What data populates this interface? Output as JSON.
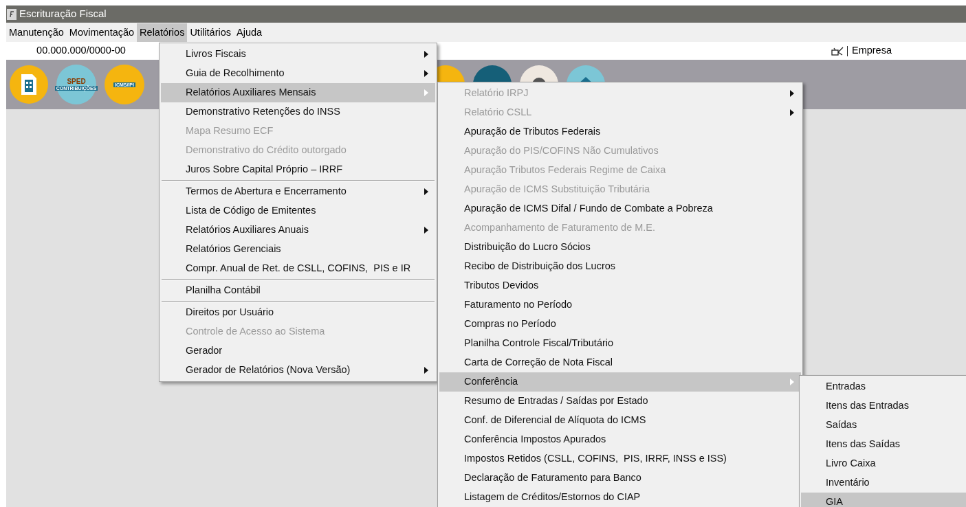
{
  "window": {
    "title": "Escrituração Fiscal"
  },
  "menubar": [
    {
      "label": "Manutenção",
      "selected": false
    },
    {
      "label": "Movimentação",
      "selected": false
    },
    {
      "label": "Relatórios",
      "selected": true
    },
    {
      "label": "Utilitários",
      "selected": false
    },
    {
      "label": "Ajuda",
      "selected": false
    }
  ],
  "company_bar": {
    "cnpj": "00.000.000/0000-00",
    "company_label": "Empresa"
  },
  "toolbar": [
    {
      "kind": "building"
    },
    {
      "kind": "sped",
      "labels": [
        "SPED",
        "CONTRIBUIÇÕES"
      ]
    },
    {
      "kind": "icms",
      "labels": [
        "ICMS/IPI"
      ]
    },
    {
      "kind": "yellow"
    },
    {
      "kind": "teal"
    },
    {
      "kind": "person"
    },
    {
      "kind": "house"
    }
  ],
  "menus": [
    {
      "items": [
        {
          "kind": "item",
          "label": "Livros Fiscais",
          "submenu": true,
          "disabled": false,
          "selected": false
        },
        {
          "kind": "item",
          "label": "Guia de Recolhimento",
          "submenu": true,
          "disabled": false,
          "selected": false
        },
        {
          "kind": "item",
          "label": "Relatórios Auxiliares Mensais",
          "submenu": true,
          "disabled": false,
          "selected": true
        },
        {
          "kind": "item",
          "label": "Demonstrativo Retenções do INSS",
          "submenu": false,
          "disabled": false,
          "selected": false
        },
        {
          "kind": "item",
          "label": "Mapa Resumo ECF",
          "submenu": false,
          "disabled": true,
          "selected": false
        },
        {
          "kind": "item",
          "label": "Demonstrativo do Crédito outorgado",
          "submenu": false,
          "disabled": true,
          "selected": false
        },
        {
          "kind": "item",
          "label": "Juros Sobre Capital Próprio – IRRF",
          "submenu": false,
          "disabled": false,
          "selected": false
        },
        {
          "kind": "separator"
        },
        {
          "kind": "item",
          "label": "Termos de Abertura e Encerramento",
          "submenu": true,
          "disabled": false,
          "selected": false
        },
        {
          "kind": "item",
          "label": "Lista de Código de Emitentes",
          "submenu": false,
          "disabled": false,
          "selected": false
        },
        {
          "kind": "item",
          "label": "Relatórios Auxiliares Anuais",
          "submenu": true,
          "disabled": false,
          "selected": false
        },
        {
          "kind": "item",
          "label": "Relatórios Gerenciais",
          "submenu": false,
          "disabled": false,
          "selected": false
        },
        {
          "kind": "item",
          "label": "Compr. Anual de Ret. de CSLL, COFINS,  PIS e IR",
          "submenu": false,
          "disabled": false,
          "selected": false
        },
        {
          "kind": "separator"
        },
        {
          "kind": "item",
          "label": "Planilha Contábil",
          "submenu": false,
          "disabled": false,
          "selected": false
        },
        {
          "kind": "separator"
        },
        {
          "kind": "item",
          "label": "Direitos por Usuário",
          "submenu": false,
          "disabled": false,
          "selected": false
        },
        {
          "kind": "item",
          "label": "Controle de Acesso ao Sistema",
          "submenu": false,
          "disabled": true,
          "selected": false
        },
        {
          "kind": "item",
          "label": "Gerador",
          "submenu": false,
          "disabled": false,
          "selected": false
        },
        {
          "kind": "item",
          "label": "Gerador de Relatórios (Nova Versão)",
          "submenu": true,
          "disabled": false,
          "selected": false
        }
      ]
    },
    {
      "items": [
        {
          "kind": "item",
          "label": "Relatório IRPJ",
          "submenu": true,
          "disabled": true,
          "selected": false
        },
        {
          "kind": "item",
          "label": "Relatório CSLL",
          "submenu": true,
          "disabled": true,
          "selected": false
        },
        {
          "kind": "item",
          "label": "Apuração de Tributos Federais",
          "submenu": false,
          "disabled": false,
          "selected": false
        },
        {
          "kind": "item",
          "label": "Apuração do PIS/COFINS Não Cumulativos",
          "submenu": false,
          "disabled": true,
          "selected": false
        },
        {
          "kind": "item",
          "label": "Apuração Tributos Federais Regime de Caixa",
          "submenu": false,
          "disabled": true,
          "selected": false
        },
        {
          "kind": "item",
          "label": "Apuração de ICMS Substituição Tributária",
          "submenu": false,
          "disabled": true,
          "selected": false
        },
        {
          "kind": "item",
          "label": "Apuração de ICMS Difal / Fundo de Combate a Pobreza",
          "submenu": false,
          "disabled": false,
          "selected": false
        },
        {
          "kind": "item",
          "label": "Acompanhamento de Faturamento de M.E.",
          "submenu": false,
          "disabled": true,
          "selected": false
        },
        {
          "kind": "item",
          "label": "Distribuição do Lucro Sócios",
          "submenu": false,
          "disabled": false,
          "selected": false
        },
        {
          "kind": "item",
          "label": "Recibo de Distribuição dos Lucros",
          "submenu": false,
          "disabled": false,
          "selected": false
        },
        {
          "kind": "item",
          "label": "Tributos Devidos",
          "submenu": false,
          "disabled": false,
          "selected": false
        },
        {
          "kind": "item",
          "label": "Faturamento no Período",
          "submenu": false,
          "disabled": false,
          "selected": false
        },
        {
          "kind": "item",
          "label": "Compras no Período",
          "submenu": false,
          "disabled": false,
          "selected": false
        },
        {
          "kind": "item",
          "label": "Planilha Controle Fiscal/Tributário",
          "submenu": false,
          "disabled": false,
          "selected": false
        },
        {
          "kind": "item",
          "label": "Carta de Correção de Nota Fiscal",
          "submenu": false,
          "disabled": false,
          "selected": false
        },
        {
          "kind": "item",
          "label": "Conferência",
          "submenu": true,
          "disabled": false,
          "selected": true
        },
        {
          "kind": "item",
          "label": "Resumo de Entradas / Saídas por Estado",
          "submenu": false,
          "disabled": false,
          "selected": false
        },
        {
          "kind": "item",
          "label": "Conf. de Diferencial de Alíquota do ICMS",
          "submenu": false,
          "disabled": false,
          "selected": false
        },
        {
          "kind": "item",
          "label": "Conferência Impostos Apurados",
          "submenu": false,
          "disabled": false,
          "selected": false
        },
        {
          "kind": "item",
          "label": "Impostos Retidos (CSLL, COFINS,  PIS, IRRF, INSS e ISS)",
          "submenu": false,
          "disabled": false,
          "selected": false
        },
        {
          "kind": "item",
          "label": "Declaração de Faturamento para Banco",
          "submenu": false,
          "disabled": false,
          "selected": false
        },
        {
          "kind": "item",
          "label": "Listagem de Créditos/Estornos do CIAP",
          "submenu": false,
          "disabled": false,
          "selected": false
        }
      ]
    },
    {
      "items": [
        {
          "kind": "item",
          "label": "Entradas",
          "submenu": false,
          "disabled": false,
          "selected": false
        },
        {
          "kind": "item",
          "label": "Itens das Entradas",
          "submenu": false,
          "disabled": false,
          "selected": false
        },
        {
          "kind": "item",
          "label": "Saídas",
          "submenu": false,
          "disabled": false,
          "selected": false
        },
        {
          "kind": "item",
          "label": "Itens das Saídas",
          "submenu": false,
          "disabled": false,
          "selected": false
        },
        {
          "kind": "item",
          "label": "Livro Caixa",
          "submenu": false,
          "disabled": false,
          "selected": false
        },
        {
          "kind": "item",
          "label": "Inventário",
          "submenu": false,
          "disabled": false,
          "selected": false
        },
        {
          "kind": "item",
          "label": "GIA",
          "submenu": false,
          "disabled": false,
          "selected": true
        }
      ]
    }
  ]
}
